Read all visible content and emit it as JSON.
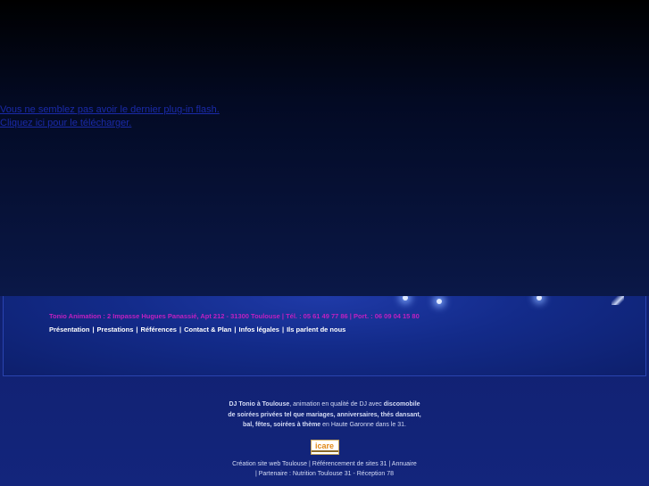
{
  "flash": {
    "line1": "Vous ne semblez pas avoir le dernier plug-in flash.",
    "line2": "Cliquez ici pour le télécharger."
  },
  "contact": {
    "info": "Tonio Animation : 2 Impasse Hugues Panassié, Apt 212 - 31300 Toulouse | Tél. : 05 61 49 77 86 | Port. : 06 09 04 15 80"
  },
  "nav": {
    "items": [
      {
        "label": "Présentation"
      },
      {
        "label": "Prestations"
      },
      {
        "label": "Références"
      },
      {
        "label": "Contact & Plan"
      },
      {
        "label": "Infos légales"
      },
      {
        "label": "Ils parlent de nous"
      }
    ]
  },
  "footer": {
    "p1_a": "DJ Tonio à Toulouse",
    "p1_b": ", animation en qualité de DJ avec ",
    "p1_c": "discomobile",
    "p2_a": "de soirées privées tel que mariages, anniversaires, thés dansant,",
    "p3_a": "bal, fêtes, soirées à thème",
    "p3_b": " en Haute Garonne dans le 31.",
    "logo_text": "icare",
    "links_row1": [
      {
        "label": "Création site web Toulouse"
      },
      {
        "label": "Référencement de sites 31"
      },
      {
        "label": "Annuaire"
      }
    ],
    "links_row2": [
      {
        "label": "Partenaire : Nutrition Toulouse 31"
      },
      {
        "label": "Réception 78"
      }
    ]
  },
  "colors": {
    "contact_text": "#c020c0",
    "flash_link": "#1a2aa8",
    "background": "#10206e"
  }
}
